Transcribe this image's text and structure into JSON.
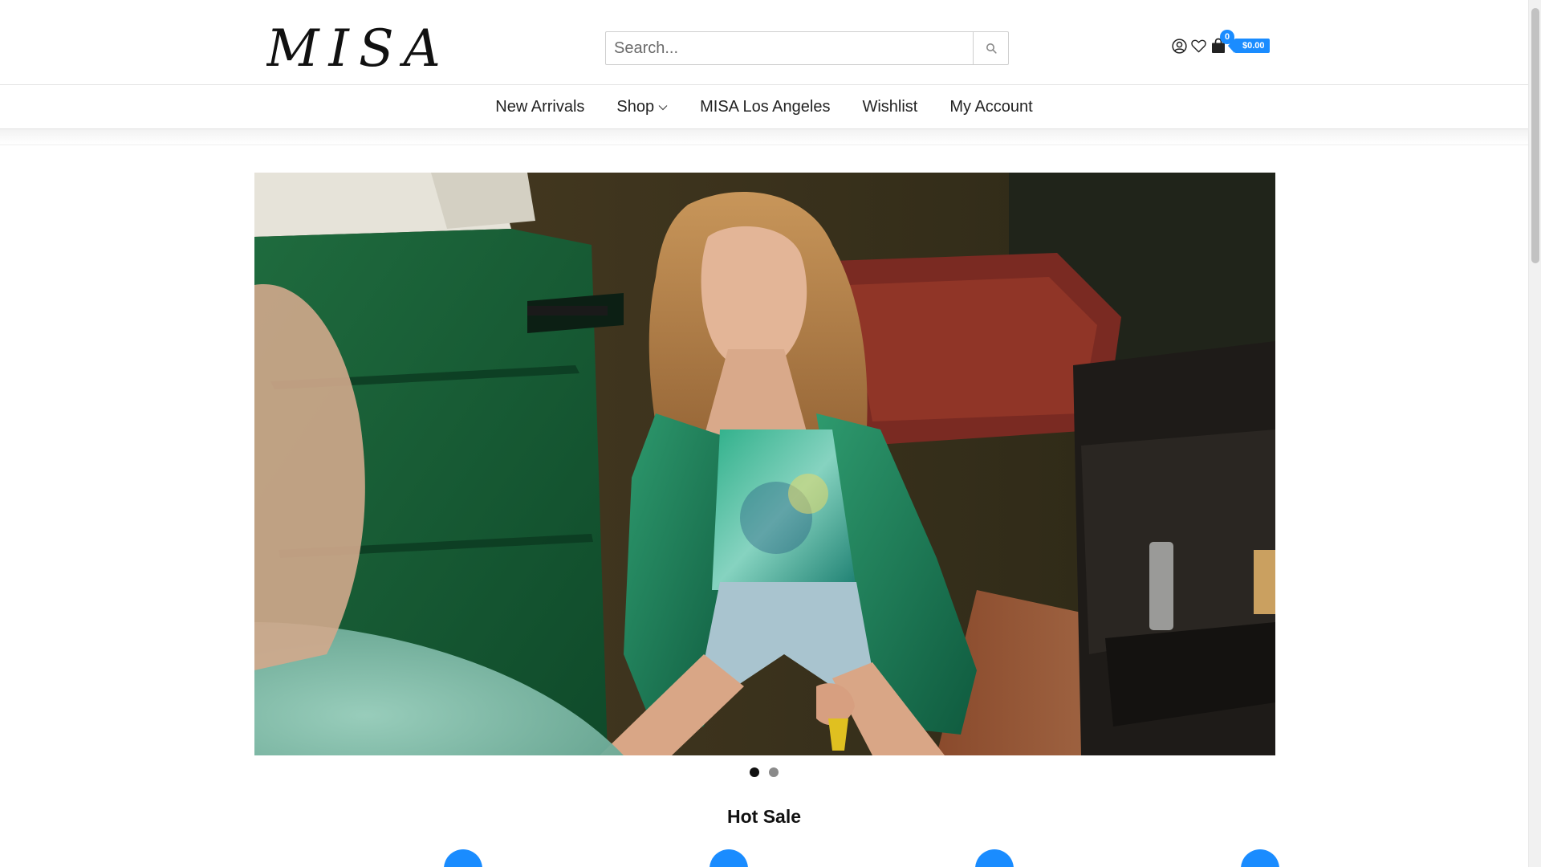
{
  "header": {
    "logo_text": "MISA",
    "search_placeholder": "Search...",
    "icons": [
      "user-icon",
      "heart-icon",
      "shopping-bag-icon",
      "search-icon"
    ],
    "cart": {
      "count": "0",
      "total": "$0.00"
    }
  },
  "nav": {
    "items": [
      {
        "label": "New Arrivals"
      },
      {
        "label": "Shop",
        "has_dropdown": true
      },
      {
        "label": "MISA Los Angeles"
      },
      {
        "label": "Wishlist"
      },
      {
        "label": "My Account"
      }
    ]
  },
  "hero": {
    "slides": 2,
    "active_slide": 1
  },
  "section": {
    "title": "Hot Sale"
  },
  "colors": {
    "accent": "#1a8cff",
    "text": "#222222",
    "border": "#e3e3e3"
  }
}
